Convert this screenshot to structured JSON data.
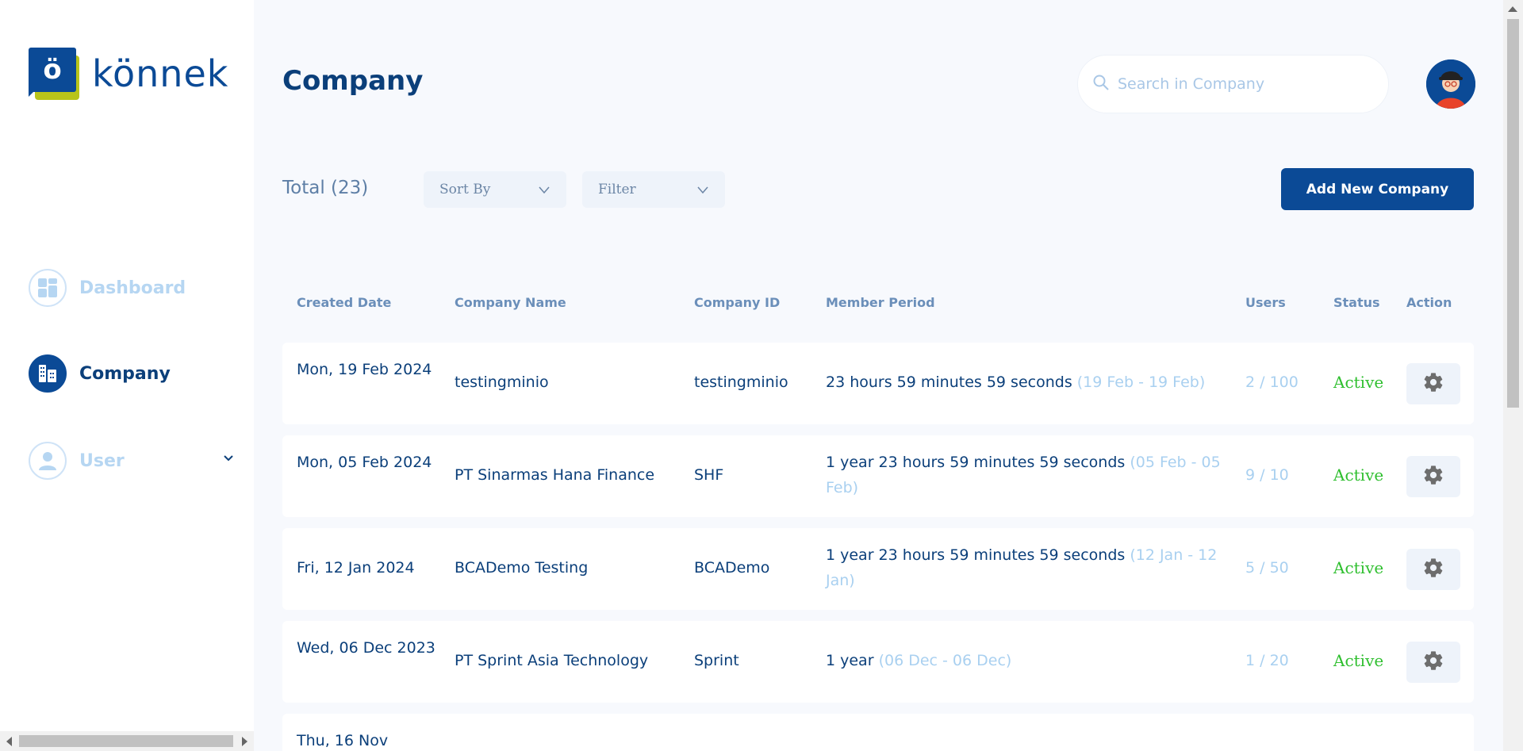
{
  "logo": {
    "mark": "ö",
    "text": "könnek"
  },
  "sidebar": {
    "items": [
      {
        "label": "Dashboard",
        "icon": "dashboard-icon",
        "active": false
      },
      {
        "label": "Company",
        "icon": "building-icon",
        "active": true
      },
      {
        "label": "User",
        "icon": "user-icon",
        "active": false
      }
    ]
  },
  "header": {
    "title": "Company",
    "search_placeholder": "Search in Company"
  },
  "toolbar": {
    "total": "Total (23)",
    "sort_label": "Sort By",
    "filter_label": "Filter",
    "add_label": "Add New Company"
  },
  "table": {
    "columns": [
      "Created Date",
      "Company Name",
      "Company ID",
      "Member Period",
      "Users",
      "Status",
      "Action"
    ],
    "rows": [
      {
        "date": "Mon, 19 Feb 2024",
        "name": "testingminio",
        "id": "testingminio",
        "period": "23 hours 59 minutes 59 seconds",
        "range": "(19 Feb - 19 Feb)",
        "users": "2 / 100",
        "status": "Active"
      },
      {
        "date": "Mon, 05 Feb 2024",
        "name": "PT Sinarmas Hana Finance",
        "id": "SHF",
        "period": "1 year 23 hours 59 minutes 59 seconds",
        "range": "(05 Feb - 05 Feb)",
        "users": "9 / 10",
        "status": "Active"
      },
      {
        "date": "Fri, 12 Jan 2024",
        "name": "BCADemo Testing",
        "id": "BCADemo",
        "period": "1 year 23 hours 59 minutes 59 seconds",
        "range": "(12 Jan - 12 Jan)",
        "users": "5 / 50",
        "status": "Active"
      },
      {
        "date": "Wed, 06 Dec 2023",
        "name": "PT Sprint Asia Technology",
        "id": "Sprint",
        "period": "1 year",
        "range": "(06 Dec - 06 Dec)",
        "users": "1 / 20",
        "status": "Active"
      },
      {
        "date": "Thu, 16 Nov",
        "name": "",
        "id": "",
        "period": "",
        "range": "",
        "users": "",
        "status": ""
      }
    ]
  },
  "colors": {
    "primary": "#0b4a96",
    "accent": "#b8c41a",
    "status_active": "#2fbf2f",
    "muted": "#a9d0f0"
  }
}
